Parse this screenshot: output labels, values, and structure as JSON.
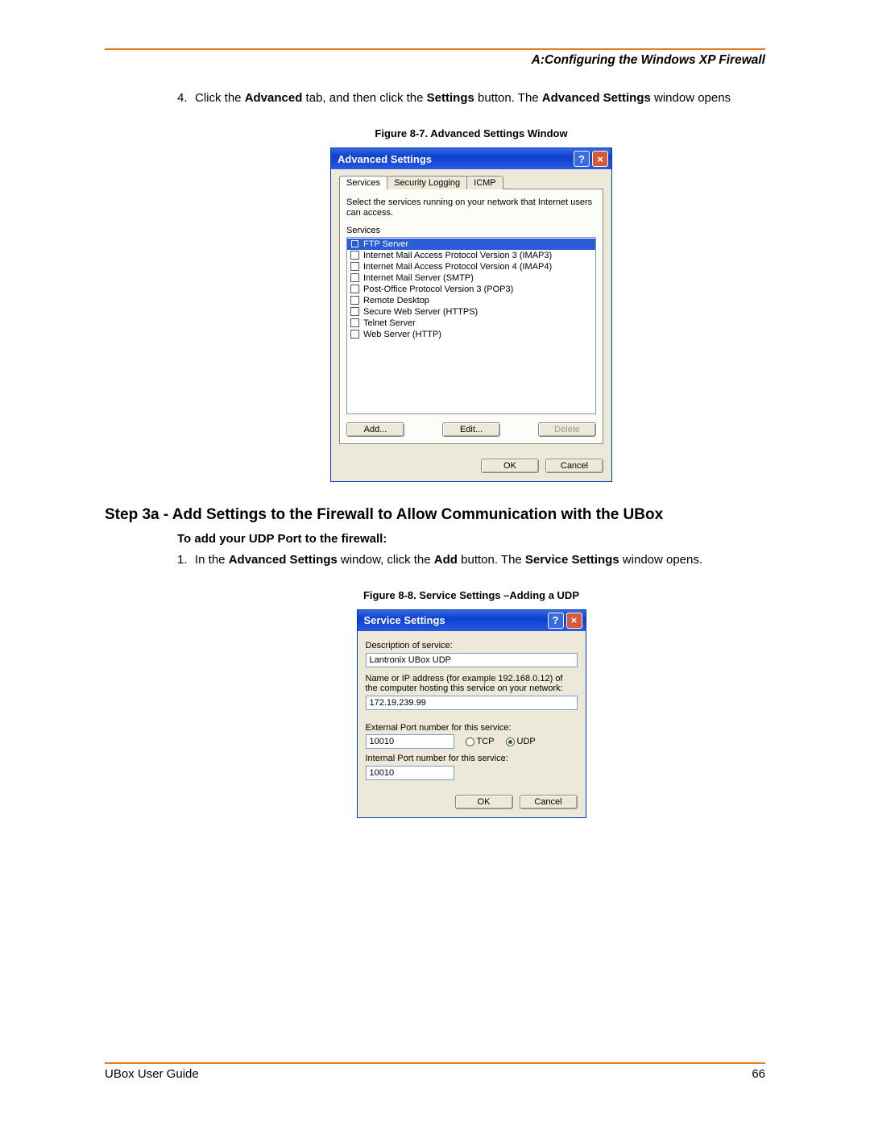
{
  "header": {
    "title": "A:Configuring the Windows XP Firewall"
  },
  "step4": {
    "num": "4.",
    "pre": "Click the ",
    "b1": "Advanced",
    "mid1": " tab, and then click the ",
    "b2": "Settings",
    "mid2": " button. The ",
    "b3": "Advanced Settings",
    "post": " window opens"
  },
  "fig1_caption": "Figure 8-7. Advanced Settings Window",
  "adv": {
    "title": "Advanced Settings",
    "tabs": {
      "t0": "Services",
      "t1": "Security Logging",
      "t2": "ICMP"
    },
    "hint": "Select the services running on your network that Internet users can access.",
    "label": "Services",
    "items": {
      "i0": "FTP Server",
      "i1": "Internet Mail Access Protocol Version 3 (IMAP3)",
      "i2": "Internet Mail Access Protocol Version 4 (IMAP4)",
      "i3": "Internet Mail Server (SMTP)",
      "i4": "Post-Office Protocol Version 3 (POP3)",
      "i5": "Remote Desktop",
      "i6": "Secure Web Server (HTTPS)",
      "i7": "Telnet Server",
      "i8": "Web Server (HTTP)"
    },
    "btn_add": "Add...",
    "btn_edit": "Edit...",
    "btn_delete": "Delete",
    "btn_ok": "OK",
    "btn_cancel": "Cancel"
  },
  "section_heading": "Step 3a - Add Settings to the Firewall to Allow Communication with the UBox",
  "sub_heading": "To add your UDP Port to the firewall:",
  "step1b": {
    "num": "1.",
    "pre": "In the ",
    "b1": "Advanced Settings",
    "mid1": " window, click the ",
    "b2": "Add",
    "mid2": " button. The ",
    "b3": "Service Settings",
    "post": " window opens."
  },
  "fig2_caption": "Figure 8-8. Service Settings –Adding a UDP",
  "svc": {
    "title": "Service Settings",
    "desc_label": "Description of service:",
    "desc_value": "Lantronix UBox UDP",
    "addr_label": "Name or IP address (for example 192.168.0.12) of the computer hosting this service on your network:",
    "addr_value": "172.19.239.99",
    "ext_label": "External Port number for this service:",
    "ext_value": "10010",
    "tcp": "TCP",
    "udp": "UDP",
    "int_label": "Internal Port number for this service:",
    "int_value": "10010",
    "btn_ok": "OK",
    "btn_cancel": "Cancel"
  },
  "footer": {
    "left": "UBox User Guide",
    "right": "66"
  }
}
